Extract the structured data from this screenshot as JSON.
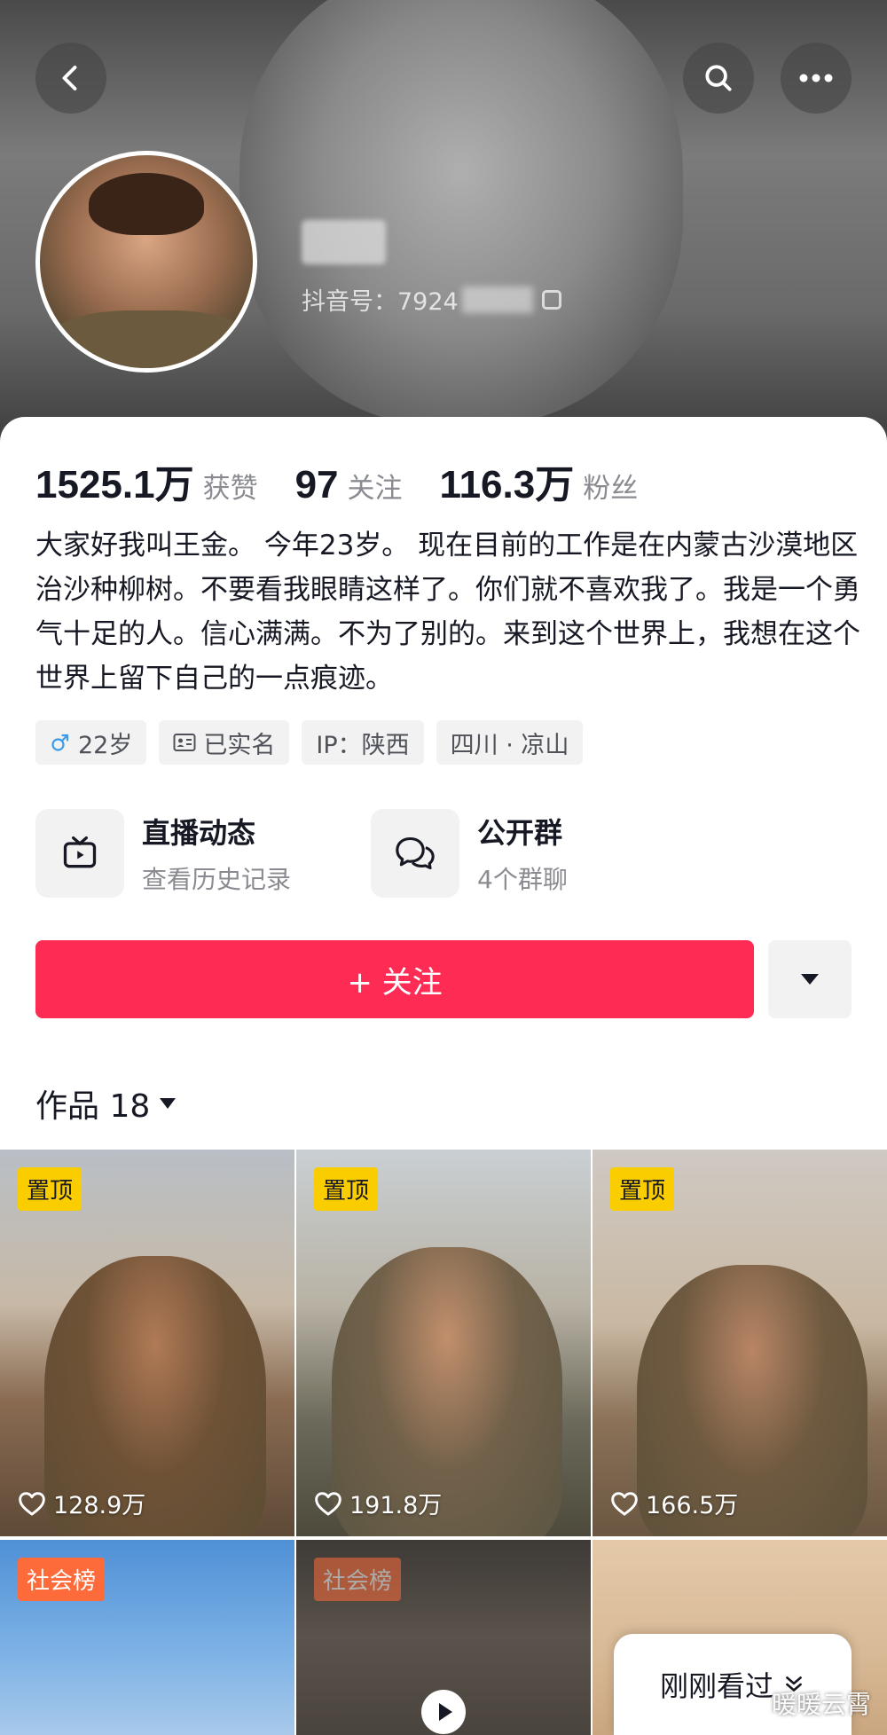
{
  "profile": {
    "douyin_id_label": "抖音号：7924",
    "stats": [
      {
        "value": "1525.1万",
        "label": "获赞"
      },
      {
        "value": "97",
        "label": "关注"
      },
      {
        "value": "116.3万",
        "label": "粉丝"
      }
    ],
    "bio": "大家好我叫王金。 今年23岁。 现在目前的工作是在内蒙古沙漠地区治沙种柳树。不要看我眼睛这样了。你们就不喜欢我了。我是一个勇气十足的人。信心满满。不为了别的。来到这个世界上，我想在这个世界上留下自己的一点痕迹。",
    "tags": {
      "age": "22岁",
      "verified": "已实名",
      "ip": "IP：陕西",
      "location": "四川 · 凉山"
    }
  },
  "features": {
    "live": {
      "title": "直播动态",
      "subtitle": "查看历史记录"
    },
    "group": {
      "title": "公开群",
      "subtitle": "4个群聊"
    }
  },
  "actions": {
    "follow_label": "+ 关注"
  },
  "works": {
    "label": "作品 18"
  },
  "videos": [
    {
      "badge": "置顶",
      "likes": "128.9万"
    },
    {
      "badge": "置顶",
      "likes": "191.8万"
    },
    {
      "badge": "置顶",
      "likes": "166.5万"
    },
    {
      "badge": "社会榜"
    },
    {
      "badge": "社会榜"
    },
    {}
  ],
  "recent": {
    "label": "刚刚看过"
  },
  "watermark": "暖暖云霄",
  "colors": {
    "accent": "#fe2c55",
    "pin": "#facd00",
    "rank": "#fe6b3a"
  }
}
